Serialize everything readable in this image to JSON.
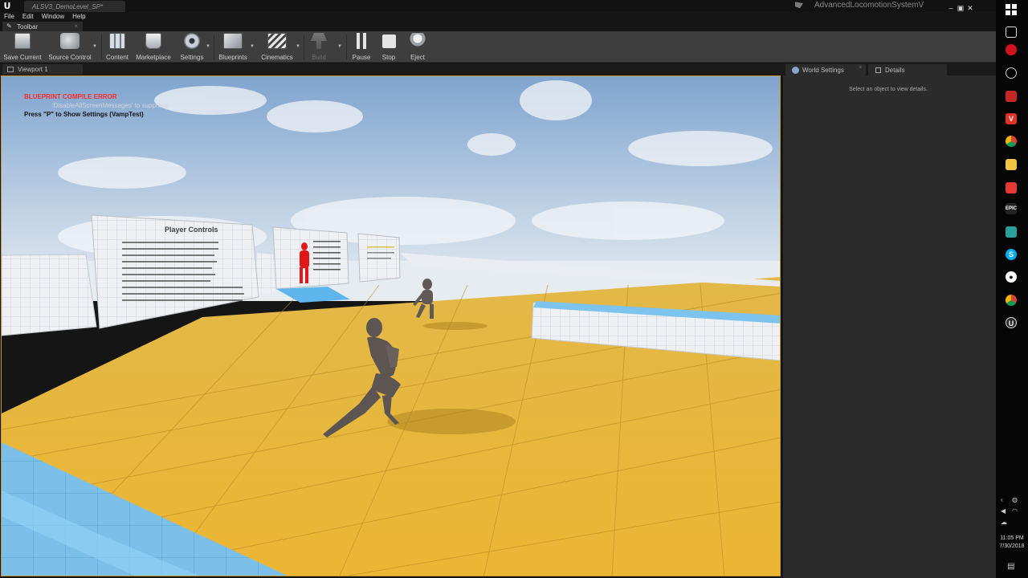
{
  "window": {
    "doc_tab": "ALSV3_DemoLevel_SP*",
    "project_name": "AdvancedLocomotionSystemV",
    "controls": [
      "–",
      "▣",
      "✕"
    ]
  },
  "menu": [
    "File",
    "Edit",
    "Window",
    "Help"
  ],
  "toolbar_tab": {
    "label": "Toolbar",
    "close": "×"
  },
  "toolbar": {
    "save_current": "Save Current",
    "source_control": "Source Control",
    "content": "Content",
    "marketplace": "Marketplace",
    "settings": "Settings",
    "blueprints": "Blueprints",
    "cinematics": "Cinematics",
    "build": "Build",
    "pause": "Pause",
    "stop": "Stop",
    "eject": "Eject"
  },
  "viewport": {
    "tab": "Viewport 1",
    "error_title": "BLUEPRINT COMPILE ERROR",
    "suppress_hint": "'DisableAllScreenMessages' to suppress",
    "settings_hint": "Press \"P\" to Show Settings (VampTest)",
    "sign_title": "Player Controls"
  },
  "right_panel": {
    "tabs": [
      {
        "label": "World Settings",
        "icon": "globe-icon"
      },
      {
        "label": "Details",
        "icon": "details-icon"
      }
    ],
    "hint": "Select an object to view details."
  },
  "taskbar": {
    "icons": [
      "windows-icon",
      "task-view-icon",
      "app-red-icon",
      "app-circle-icon",
      "app-red-car-icon",
      "vivaldi-icon",
      "chrome-icon",
      "file-explorer-icon",
      "app-red-icon-2",
      "epic-games-icon",
      "app-teal-icon",
      "skype-icon",
      "app-chat-icon",
      "chrome-icon-2",
      "unreal-engine-icon"
    ],
    "time": "11:05 PM",
    "date": "7/30/2018"
  }
}
